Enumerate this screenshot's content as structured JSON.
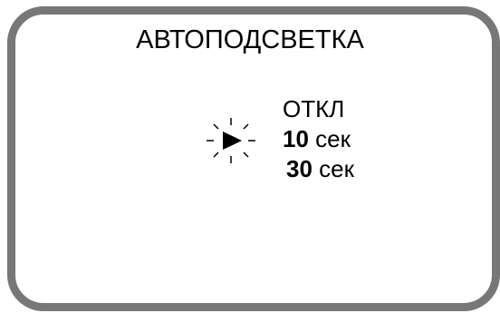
{
  "screen": {
    "title": "АВТОПОДСВЕТКА"
  },
  "menu": {
    "items": [
      {
        "label": "ОТКЛ"
      },
      {
        "number": "10",
        "unit": "сек"
      },
      {
        "number": "30",
        "unit": "сек"
      }
    ],
    "selected_index": 1
  },
  "icons": {
    "cursor": "blinking-play-arrow-icon"
  },
  "colors": {
    "frame": "#777777",
    "background": "#ffffff",
    "text": "#000000"
  }
}
